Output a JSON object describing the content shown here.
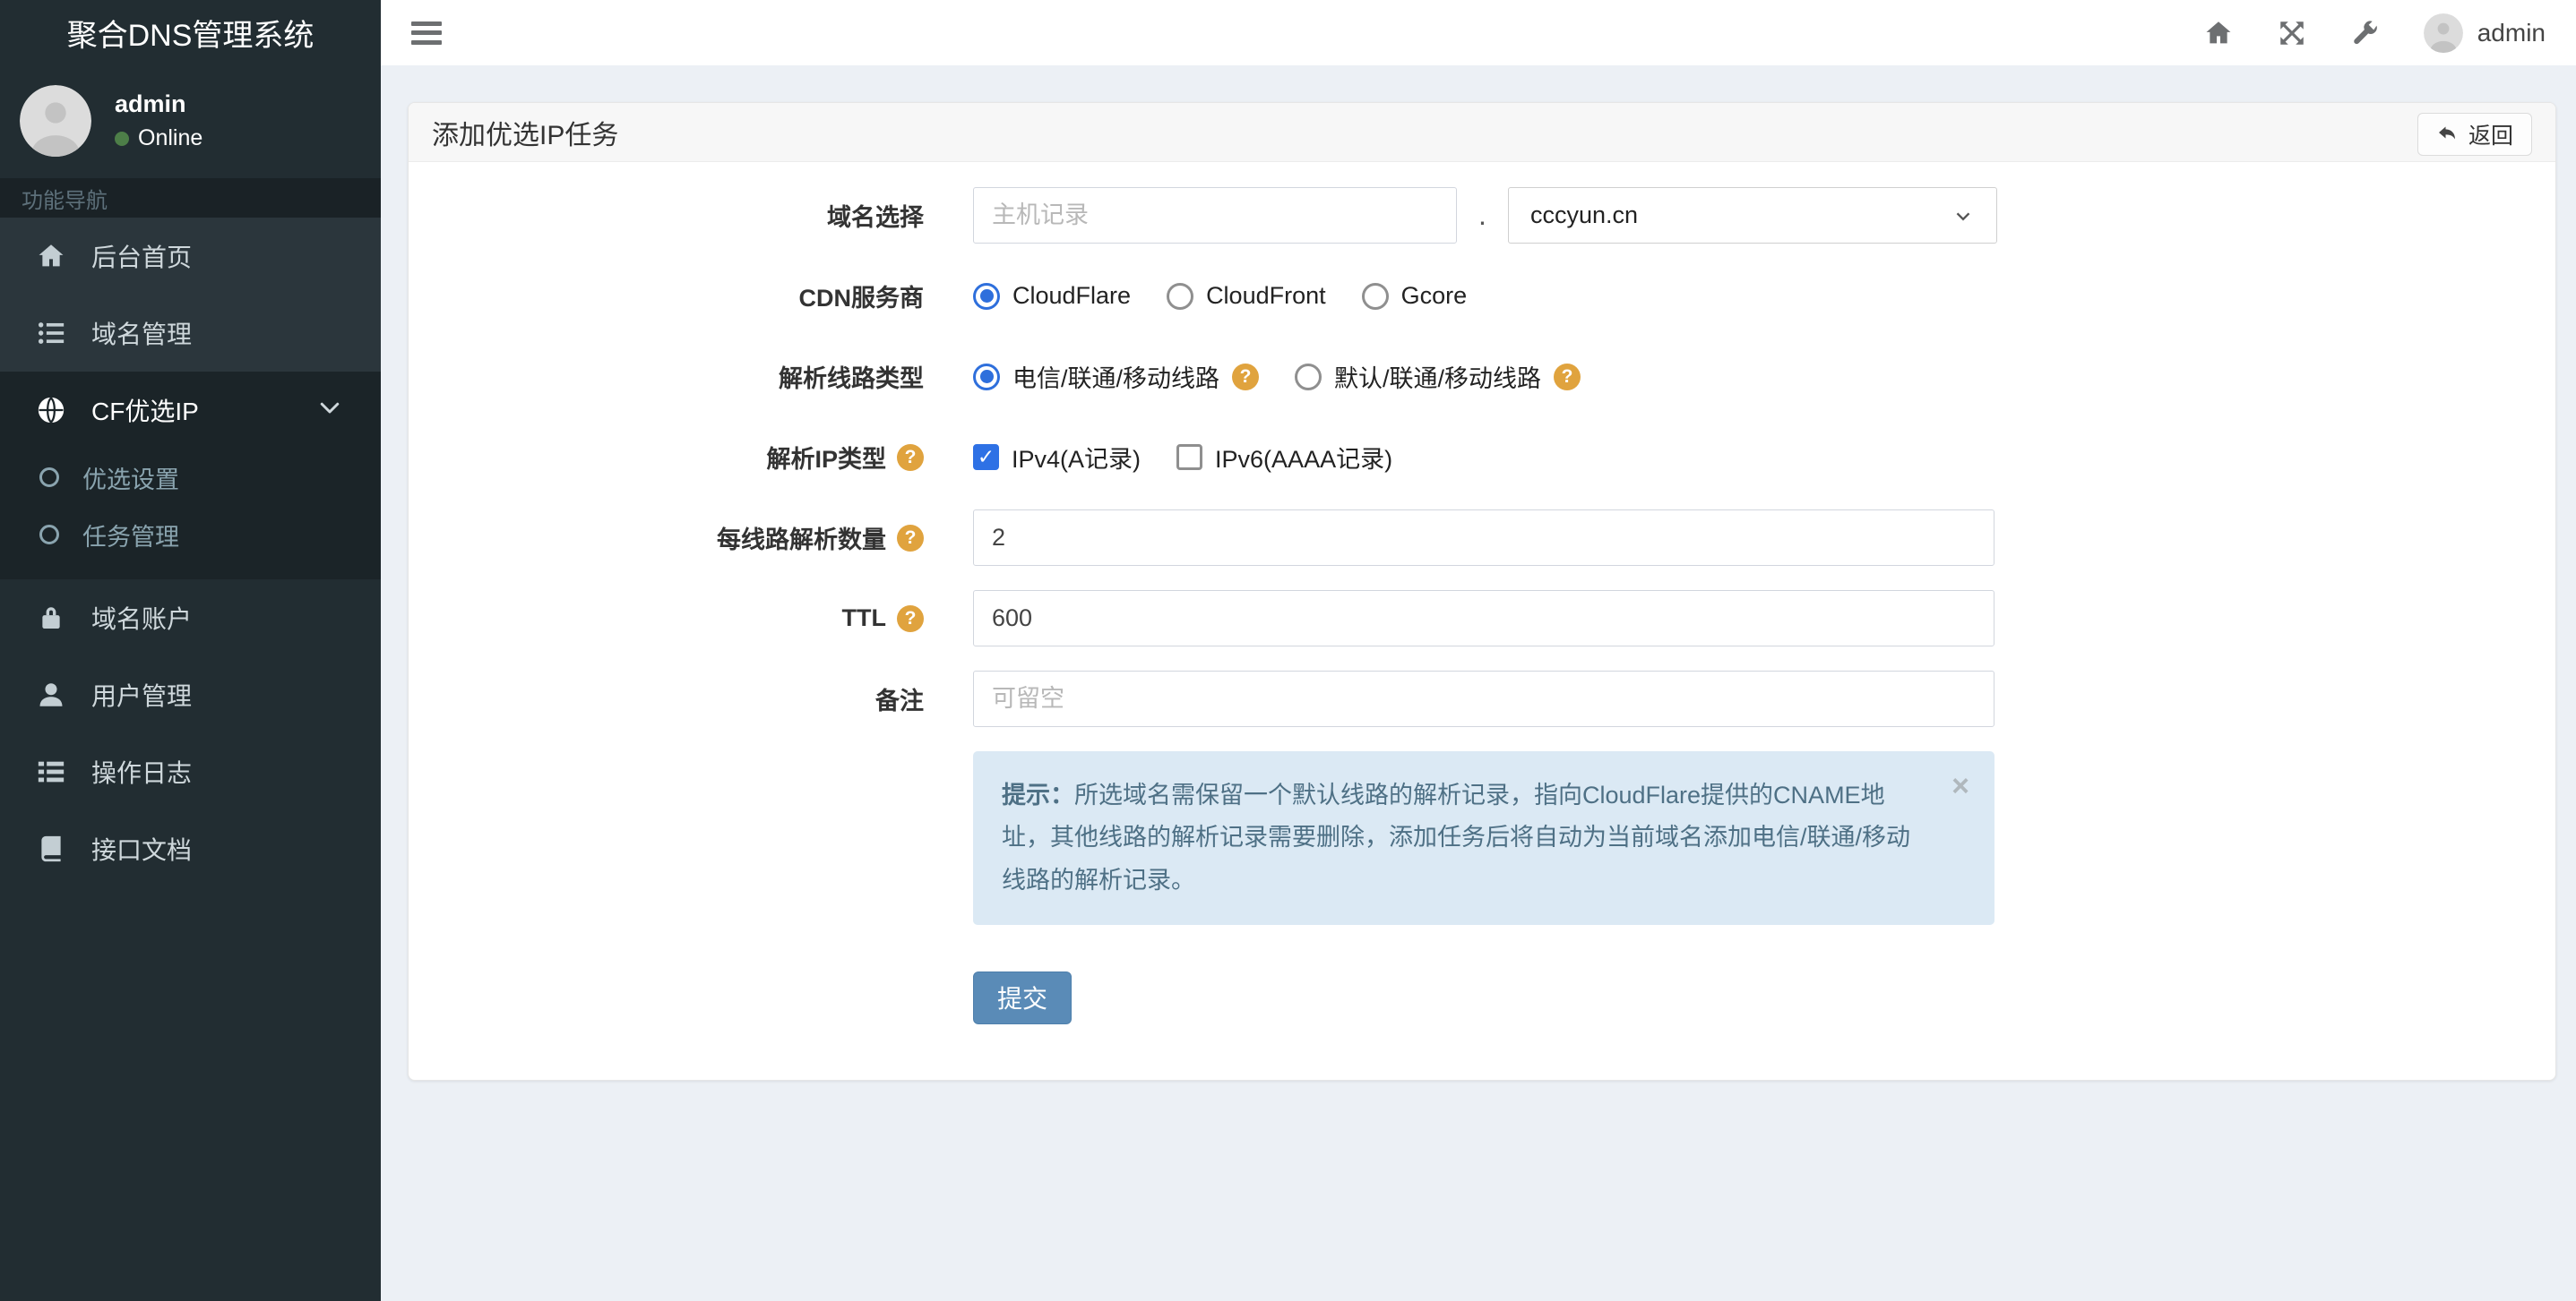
{
  "app": {
    "title": "聚合DNS管理系统"
  },
  "navbar": {
    "username": "admin",
    "icons": [
      "hamburger-icon",
      "home-icon",
      "expand-icon",
      "wrench-icon",
      "avatar"
    ]
  },
  "sidebar": {
    "user": {
      "name": "admin",
      "status": "Online"
    },
    "section_header": "功能导航",
    "items": [
      {
        "label": "后台首页",
        "icon": "home-icon"
      },
      {
        "label": "域名管理",
        "icon": "list-icon"
      },
      {
        "label": "CF优选IP",
        "icon": "globe-icon",
        "active": true,
        "children": [
          {
            "label": "优选设置",
            "icon": "circle-o-icon"
          },
          {
            "label": "任务管理",
            "icon": "circle-o-icon"
          }
        ]
      },
      {
        "label": "域名账户",
        "icon": "lock-icon"
      },
      {
        "label": "用户管理",
        "icon": "user-icon"
      },
      {
        "label": "操作日志",
        "icon": "th-list-icon"
      },
      {
        "label": "接口文档",
        "icon": "book-icon"
      }
    ]
  },
  "page": {
    "title": "添加优选IP任务",
    "back_button": "返回"
  },
  "form": {
    "domain": {
      "label": "域名选择",
      "host_placeholder": "主机记录",
      "separator": ".",
      "selected_domain": "cccyun.cn"
    },
    "cdn": {
      "label": "CDN服务商",
      "options": [
        {
          "label": "CloudFlare",
          "checked": true
        },
        {
          "label": "CloudFront",
          "checked": false
        },
        {
          "label": "Gcore",
          "checked": false
        }
      ]
    },
    "line_type": {
      "label": "解析线路类型",
      "options": [
        {
          "label": "电信/联通/移动线路",
          "checked": true,
          "help": true
        },
        {
          "label": "默认/联通/移动线路",
          "checked": false,
          "help": true
        }
      ]
    },
    "ip_type": {
      "label": "解析IP类型",
      "help": true,
      "options": [
        {
          "label": "IPv4(A记录)",
          "checked": true
        },
        {
          "label": "IPv6(AAAA记录)",
          "checked": false
        }
      ]
    },
    "per_line": {
      "label": "每线路解析数量",
      "help": true,
      "value": "2"
    },
    "ttl": {
      "label": "TTL",
      "help": true,
      "value": "600"
    },
    "remark": {
      "label": "备注",
      "placeholder": "可留空"
    },
    "tip": {
      "bold": "提示：",
      "text": "所选域名需保留一个默认线路的解析记录，指向CloudFlare提供的CNAME地址，其他线路的解析记录需要删除，添加任务后将自动为当前域名添加电信/联通/移动线路的解析记录。",
      "close": "×"
    },
    "submit": "提交"
  },
  "colors": {
    "sidebar_bg": "#222d32",
    "sidebar_active_bg": "#1b2428",
    "accent_blue": "#5a8bb7",
    "selection_blue": "#2e71e5",
    "help_orange": "#e0a33e",
    "online_green": "#4d7e48",
    "alert_bg": "#dbe9f4",
    "alert_text": "#4e7085",
    "content_bg": "#ecf0f5"
  }
}
